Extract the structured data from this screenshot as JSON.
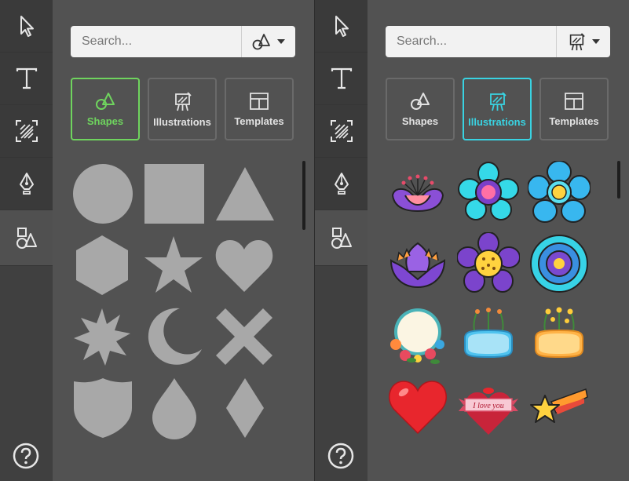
{
  "search": {
    "placeholder": "Search..."
  },
  "tabs": {
    "shapes": "Shapes",
    "illustrations": "Illustrations",
    "templates": "Templates"
  },
  "illustration_text": {
    "i_love_you": "I love you"
  },
  "colors": {
    "green_accent": "#6fd45e",
    "cyan_accent": "#39d3e2",
    "shape_fill": "#a8a8a8"
  },
  "left_panel": {
    "active_tab": "shapes",
    "shapes": [
      "circle",
      "square",
      "triangle",
      "hexagon",
      "star",
      "heart",
      "starburst",
      "crescent-moon",
      "x-cross",
      "shield",
      "droplet",
      "diamond"
    ]
  },
  "right_panel": {
    "active_tab": "illustrations",
    "illustrations": [
      "purple-lotus-flower",
      "cyan-flower",
      "blue-flower",
      "purple-lotus",
      "purple-daisy",
      "cyan-layered-flower",
      "floral-round-frame",
      "floral-blue-frame",
      "floral-yellow-frame",
      "red-heart",
      "i-love-you-heart-banner",
      "shooting-star"
    ]
  }
}
